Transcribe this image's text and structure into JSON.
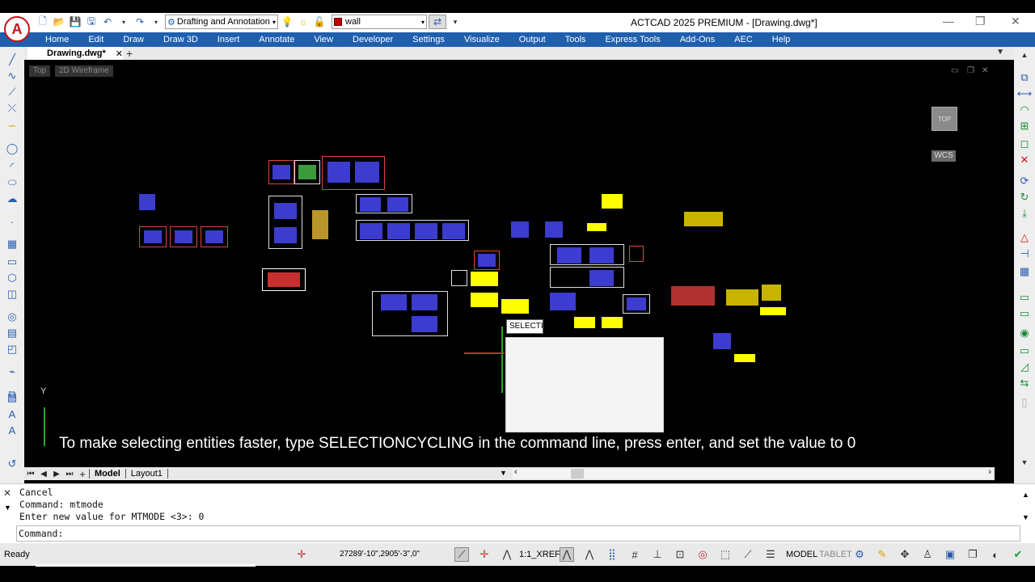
{
  "app": {
    "title": "ACTCAD 2025 PREMIUM - [Drawing.dwg*]",
    "logo_glyph": "A",
    "workspace": "Drafting and Annotation",
    "layer": "wall",
    "layer_color": "#c00000"
  },
  "menu": [
    "Home",
    "Edit",
    "Draw",
    "Draw 3D",
    "Insert",
    "Annotate",
    "View",
    "Developer",
    "Settings",
    "Visualize",
    "Output",
    "Tools",
    "Express Tools",
    "Add-Ons",
    "AEC",
    "Help"
  ],
  "doc_tab": {
    "label": "Drawing.dwg*",
    "close": "✕",
    "add": "+"
  },
  "viewport": {
    "view_label": "Top",
    "style_label": "2D Wireframe",
    "cube_label": "TOP",
    "wcs_label": "WCS",
    "ucs_y": "Y"
  },
  "dynamic_input": "SELECTI",
  "hint": "To make selecting entities faster, type SELECTIONCYCLING in the command line, press enter, and set the value to 0",
  "layout_tabs": [
    "Model",
    "Layout1"
  ],
  "command": {
    "history": [
      "Cancel",
      "Command: mtmode",
      "Enter new value for MTMODE <3>: 0"
    ],
    "prompt": "Command:"
  },
  "status": {
    "ready": "Ready",
    "coords": "27289'-10\",2905'-3\",0\"",
    "scale": "1:1_XREF",
    "model": "MODEL",
    "tablet": "TABLET"
  },
  "colors": {
    "menubar": "#1f5fae",
    "canvas": "#000000",
    "highlight": "#ffff00"
  }
}
